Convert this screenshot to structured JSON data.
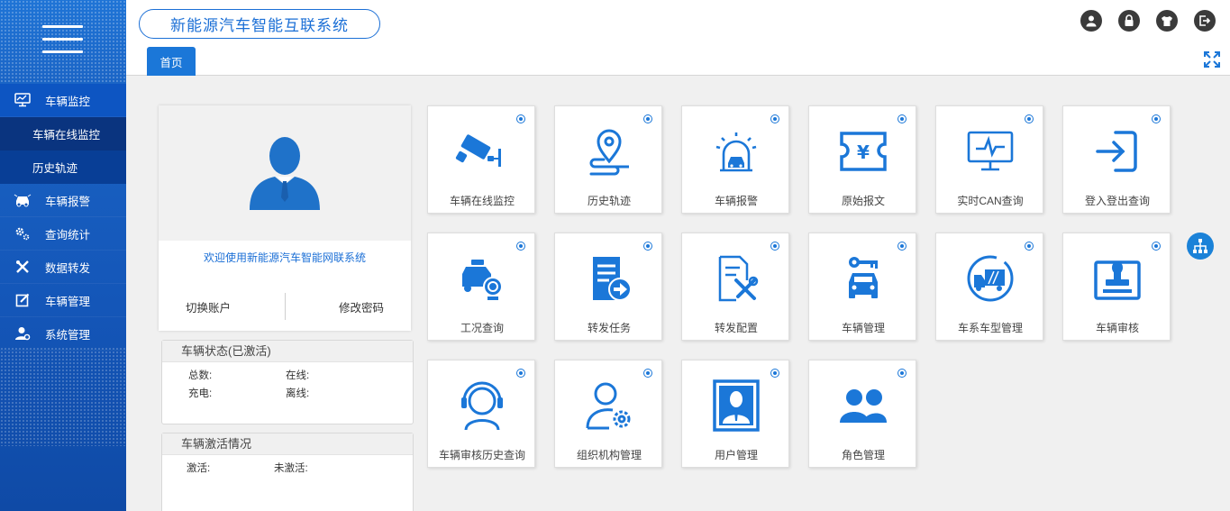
{
  "app": {
    "title": "新能源汽车智能互联系统",
    "tab_home": "首页"
  },
  "colors": {
    "primary": "#1b77d8",
    "sidebar": "#1456b8",
    "header_icon": "#3b3b3b"
  },
  "sidebar": {
    "items": [
      {
        "label": "车辆监控",
        "icon": "monitor-icon"
      },
      {
        "label": "车辆报警",
        "icon": "car-alarm-icon"
      },
      {
        "label": "查询统计",
        "icon": "gears-icon"
      },
      {
        "label": "数据转发",
        "icon": "tools-icon"
      },
      {
        "label": "车辆管理",
        "icon": "edit-icon"
      },
      {
        "label": "系统管理",
        "icon": "admin-icon"
      }
    ],
    "subitems": [
      {
        "label": "车辆在线监控"
      },
      {
        "label": "历史轨迹"
      }
    ]
  },
  "header": {
    "icons": [
      "user-icon",
      "lock-icon",
      "shirt-icon",
      "logout-icon"
    ]
  },
  "profile": {
    "welcome": "欢迎使用新能源汽车智能网联系统",
    "switch_account": "切换账户",
    "change_password": "修改密码"
  },
  "status_panel": {
    "title": "车辆状态(已激活)",
    "total_label": "总数:",
    "online_label": "在线:",
    "charging_label": "充电:",
    "offline_label": "离线:"
  },
  "activation_panel": {
    "title": "车辆激活情况",
    "activated_label": "激活:",
    "not_activated_label": "未激活:"
  },
  "tiles": [
    {
      "label": "车辆在线监控",
      "icon": "camera-icon"
    },
    {
      "label": "历史轨迹",
      "icon": "location-icon"
    },
    {
      "label": "车辆报警",
      "icon": "alarm-icon"
    },
    {
      "label": "原始报文",
      "icon": "ticket-icon"
    },
    {
      "label": "实时CAN查询",
      "icon": "screen-pulse-icon"
    },
    {
      "label": "登入登出查询",
      "icon": "login-icon"
    },
    {
      "label": "工况查询",
      "icon": "car-search-icon"
    },
    {
      "label": "转发任务",
      "icon": "forward-doc-icon"
    },
    {
      "label": "转发配置",
      "icon": "config-icon"
    },
    {
      "label": "车辆管理",
      "icon": "car-key-icon"
    },
    {
      "label": "车系车型管理",
      "icon": "truck-circle-icon"
    },
    {
      "label": "车辆审核",
      "icon": "stamp-icon"
    },
    {
      "label": "车辆审核历史查询",
      "icon": "headset-icon"
    },
    {
      "label": "组织机构管理",
      "icon": "user-gear-icon"
    },
    {
      "label": "用户管理",
      "icon": "user-frame-icon"
    },
    {
      "label": "角色管理",
      "icon": "group-icon"
    }
  ]
}
